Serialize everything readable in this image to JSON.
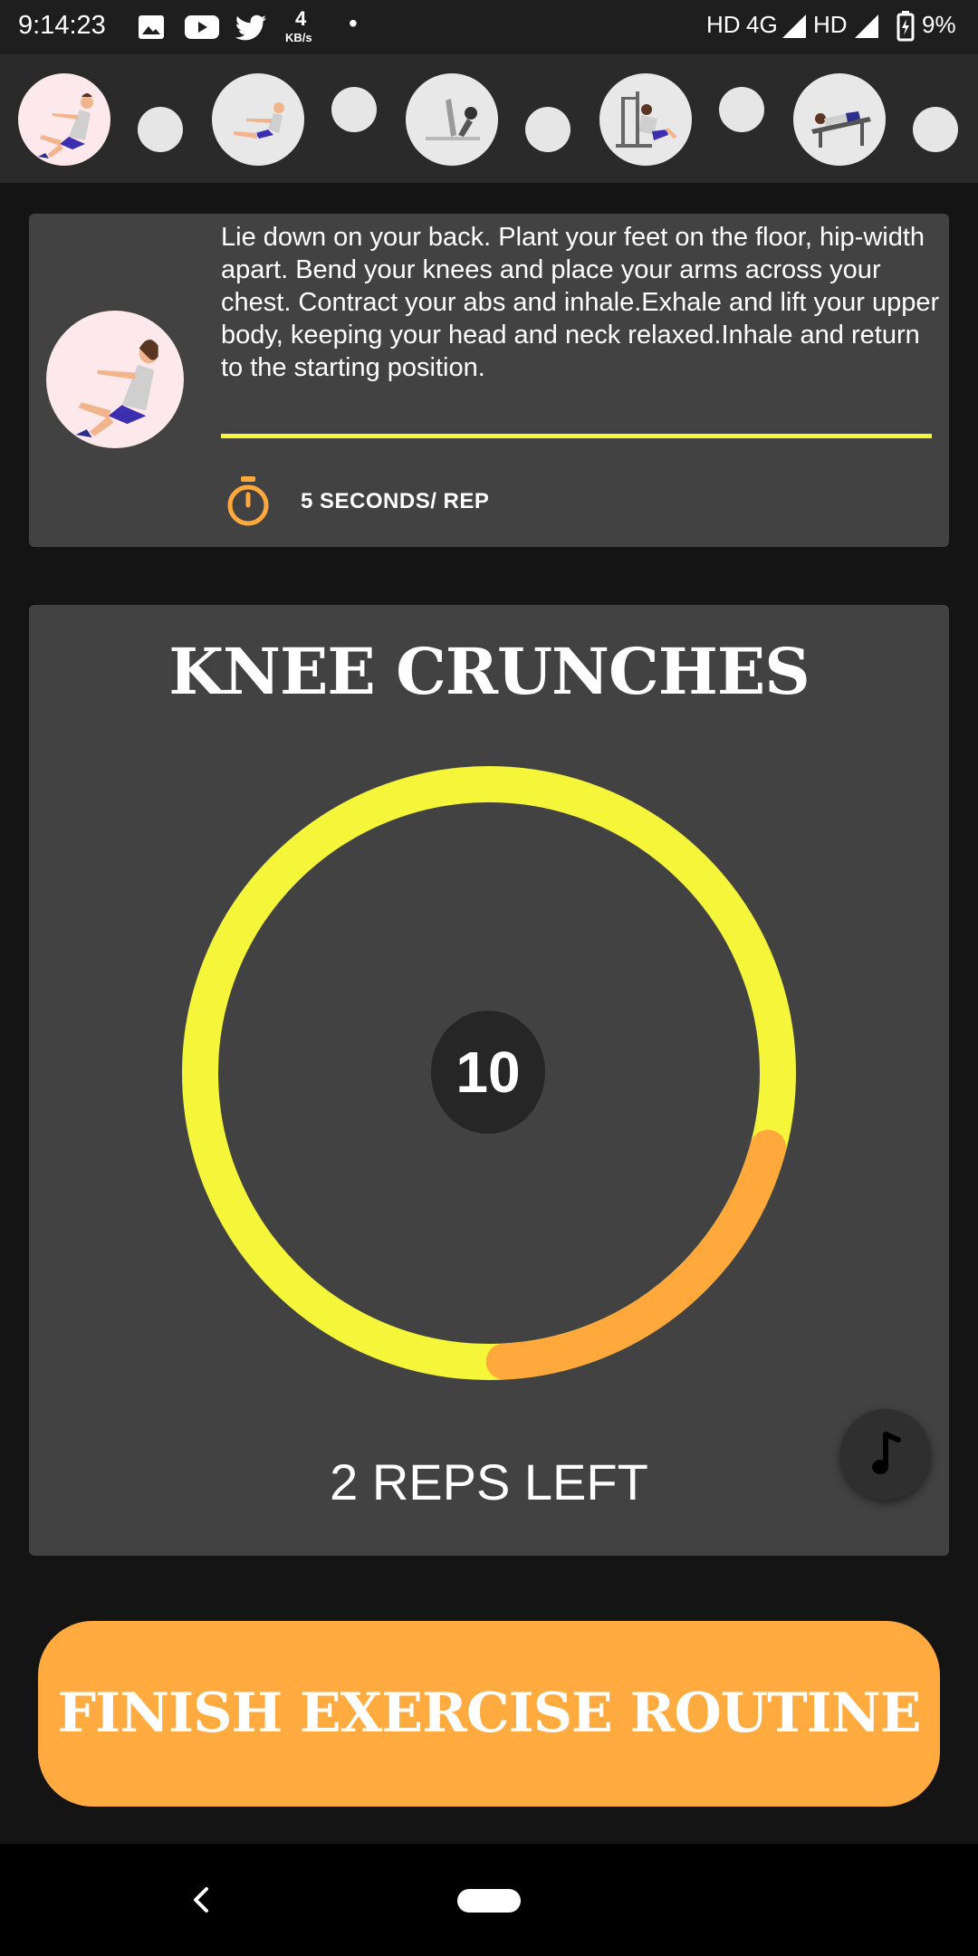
{
  "status_bar": {
    "time": "9:14:23",
    "net_speed_value": "4",
    "net_speed_unit": "KB/s",
    "dot": "•",
    "hd1": "HD",
    "network": "4G",
    "hd2": "HD",
    "battery": "9%"
  },
  "exercise_strip": {
    "thumbnails": [
      "knee-crunch-icon",
      "v-sit-icon",
      "leg-raise-icon",
      "machine-press-icon",
      "incline-bench-icon"
    ],
    "active_index": 0
  },
  "info_card": {
    "description": "Lie down on your back. Plant your feet on the floor, hip-width apart. Bend your knees and place your arms across your chest. Contract your abs and inhale.Exhale and lift your upper body, keeping your head and neck relaxed.Inhale and return to the starting position.",
    "rep_time": "5 SECONDS/ REP",
    "timer_icon": "stopwatch-icon"
  },
  "exercise": {
    "title": "KNEE CRUNCHES",
    "counter": "10",
    "reps_left": "2 REPS LEFT",
    "progress_fraction": 0.2,
    "ring_color": "#f5f53a",
    "progress_color": "#ffa83c"
  },
  "actions": {
    "finish_label": "FINISH EXERCISE ROUTINE",
    "music_icon": "music-note-icon"
  },
  "colors": {
    "accent": "#ffab40",
    "card": "#424242",
    "background": "#141414"
  }
}
